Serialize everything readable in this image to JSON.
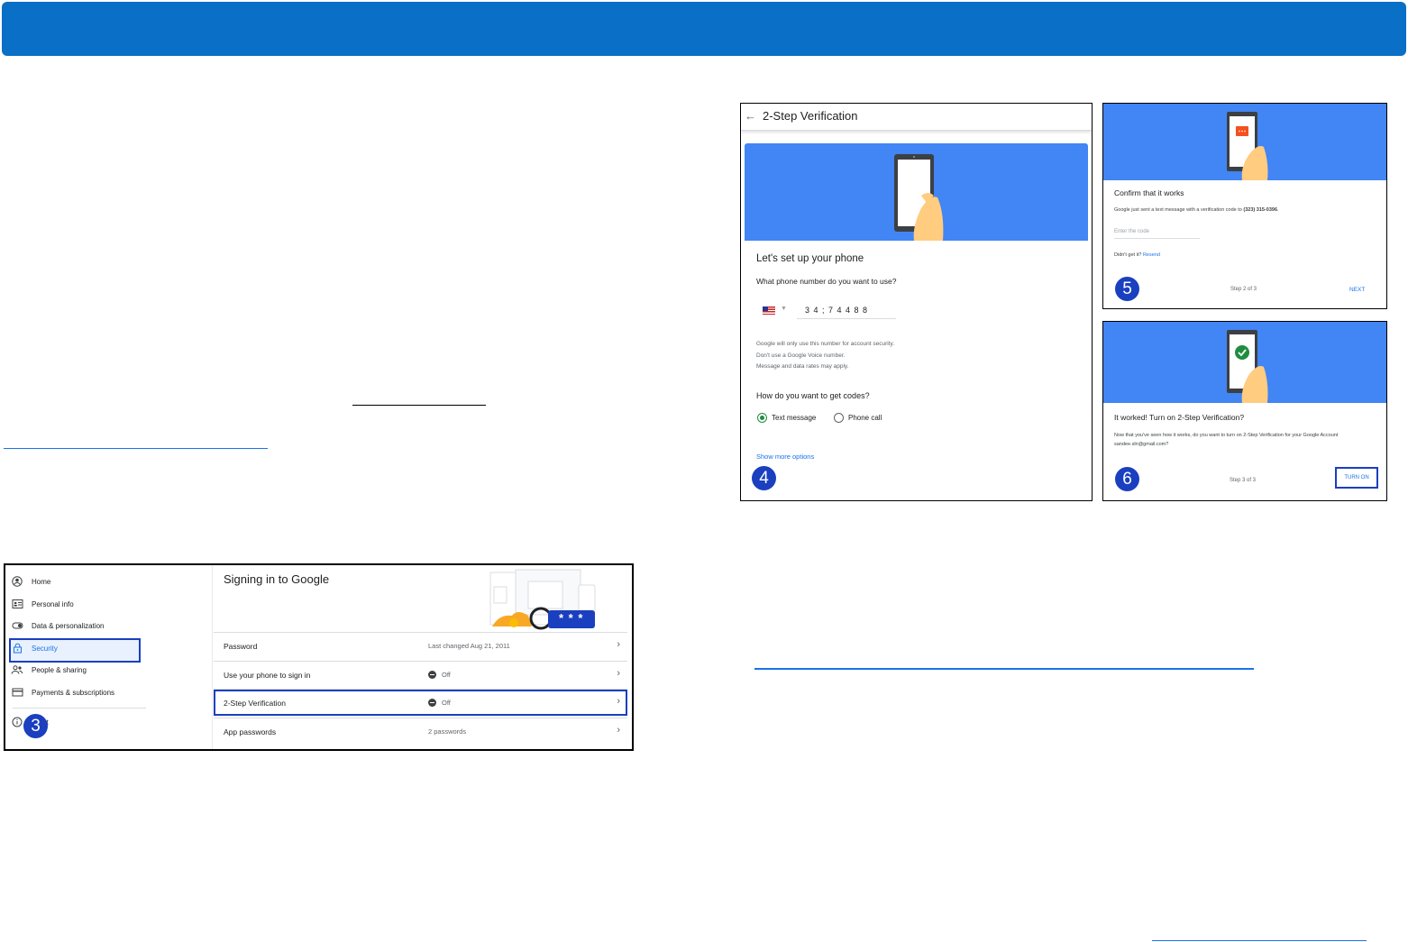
{
  "colors": {
    "banner": "#0a6fc6",
    "hero": "#4285f4",
    "badge": "#1a3fbf",
    "link": "#1a73e8",
    "radio_on": "#1e8e3e"
  },
  "panel3": {
    "badge": "3",
    "nav": [
      {
        "label": "Home",
        "icon": "account-circle-icon"
      },
      {
        "label": "Personal info",
        "icon": "id-card-icon"
      },
      {
        "label": "Data & personalization",
        "icon": "toggle-icon"
      },
      {
        "label": "Security",
        "icon": "lock-icon"
      },
      {
        "label": "People & sharing",
        "icon": "people-icon"
      },
      {
        "label": "Payments & subscriptions",
        "icon": "credit-card-icon"
      }
    ],
    "about_label": "ut",
    "section_title": "Signing in to Google",
    "rows": [
      {
        "label": "Password",
        "value": "Last changed Aug 21, 2011"
      },
      {
        "label": "Use your phone to sign in",
        "value": "Off"
      },
      {
        "label": "2-Step Verification",
        "value": "Off"
      },
      {
        "label": "App passwords",
        "value": "2 passwords"
      }
    ],
    "illustration_text": "* * *"
  },
  "panel4": {
    "badge": "4",
    "header_title": "2-Step Verification",
    "heading": "Let's set up your phone",
    "question": "What phone number do you want to use?",
    "phone_value": "3 4 ; 7 4 4 8 8",
    "notes": [
      "Google will only use this number for account security.",
      "Don't use a Google Voice number.",
      "Message and data rates may apply."
    ],
    "codes_question": "How do you want to get codes?",
    "option_text": "Text message",
    "option_call": "Phone call",
    "more_options": "Show more options"
  },
  "panel5": {
    "badge": "5",
    "title": "Confirm that it works",
    "text_before": "Google just sent a text message with a verification code to ",
    "phone": "(323) 315-0396",
    "text_after": ".",
    "placeholder": "Enter the code",
    "didnt": "Didn't get it?",
    "resend": "Resend",
    "step": "Step 2 of 3",
    "next": "NEXT"
  },
  "panel6": {
    "badge": "6",
    "title": "It worked! Turn on 2-Step Verification?",
    "text": "Now that you've seen how it works, do you want to turn on 2-Step Verification for your Google Account sandee.sln@gmail.com?",
    "step": "Step 3 of 3",
    "turn_on": "TURN ON"
  }
}
